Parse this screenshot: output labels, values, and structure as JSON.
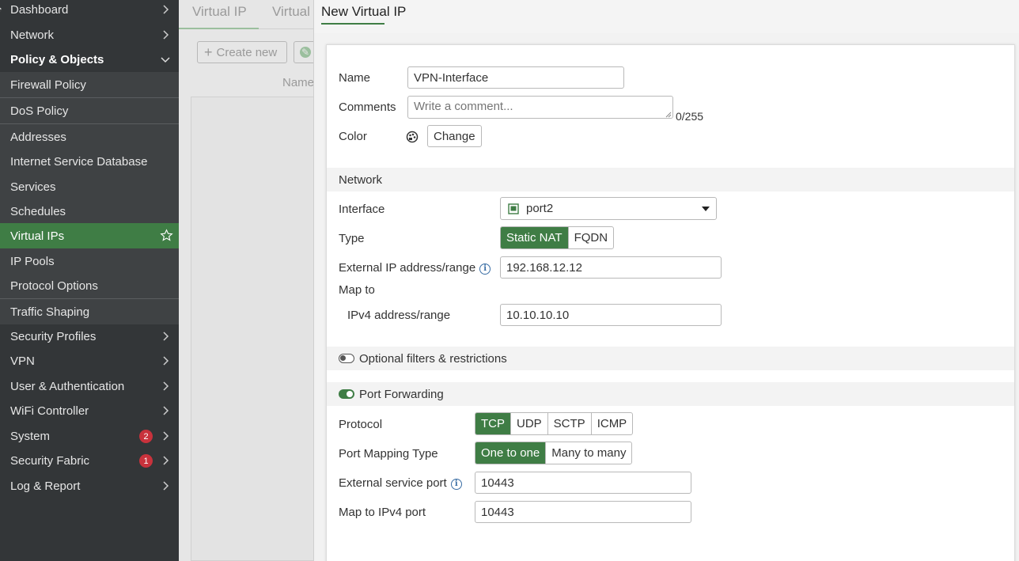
{
  "sidebar": {
    "items": [
      {
        "label": "Dashboard",
        "icon": "dashboard-icon"
      },
      {
        "label": "Network",
        "icon": "network-icon"
      },
      {
        "label": "Policy & Objects",
        "icon": "lock-icon"
      },
      {
        "label": "Firewall Policy"
      },
      {
        "label": "DoS Policy"
      },
      {
        "label": "Addresses"
      },
      {
        "label": "Internet Service Database"
      },
      {
        "label": "Services"
      },
      {
        "label": "Schedules"
      },
      {
        "label": "Virtual IPs"
      },
      {
        "label": "IP Pools"
      },
      {
        "label": "Protocol Options"
      },
      {
        "label": "Traffic Shaping"
      },
      {
        "label": "Security Profiles"
      },
      {
        "label": "VPN"
      },
      {
        "label": "User & Authentication"
      },
      {
        "label": "WiFi Controller"
      },
      {
        "label": "System",
        "badge": "2"
      },
      {
        "label": "Security Fabric",
        "badge": "1"
      },
      {
        "label": "Log & Report"
      }
    ]
  },
  "background": {
    "tabs": [
      "Virtual IP",
      "Virtual"
    ],
    "create_new": "Create new",
    "column_name": "Name"
  },
  "panel": {
    "title": "New Virtual IP",
    "name_label": "Name",
    "name_value": "VPN-Interface",
    "comments_label": "Comments",
    "comments_placeholder": "Write a comment...",
    "comments_count": "0/255",
    "color_label": "Color",
    "change_button": "Change",
    "network_section": "Network",
    "interface_label": "Interface",
    "interface_value": "port2",
    "type_label": "Type",
    "type_options": [
      "Static NAT",
      "FQDN"
    ],
    "ext_ip_label": "External IP address/range",
    "ext_ip_value": "192.168.12.12",
    "map_to_label": "Map to",
    "ipv4_label": "IPv4 address/range",
    "ipv4_value": "10.10.10.10",
    "optional_label": "Optional filters & restrictions",
    "port_forwarding_label": "Port Forwarding",
    "protocol_label": "Protocol",
    "protocol_options": [
      "TCP",
      "UDP",
      "SCTP",
      "ICMP"
    ],
    "port_mapping_label": "Port Mapping Type",
    "port_mapping_options": [
      "One to one",
      "Many to many"
    ],
    "ext_port_label": "External service port",
    "ext_port_value": "10443",
    "map_port_label": "Map to IPv4 port",
    "map_port_value": "10443"
  },
  "colors": {
    "accent": "#3f7d45",
    "sidebar_bg": "#333638",
    "badge": "#c8323c"
  }
}
